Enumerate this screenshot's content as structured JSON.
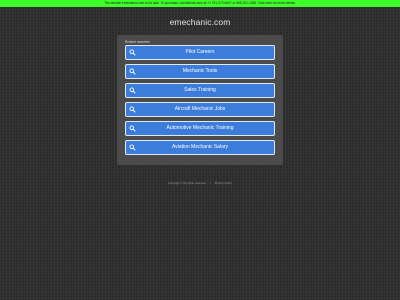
{
  "banner": {
    "text": "The domain emechanic.com is for sale. To purchase, call Afternic.com at +1 781-373-6847 or 855-201-2286. Click here for more details."
  },
  "site": {
    "title": "emechanic.com"
  },
  "panel": {
    "label": "Related searches",
    "items": [
      {
        "label": "Pilot Careers",
        "icon": "search-icon"
      },
      {
        "label": "Mechanic Tools",
        "icon": "search-icon"
      },
      {
        "label": "Sales Training",
        "icon": "search-icon"
      },
      {
        "label": "Aircraft Mechanic Jobs",
        "icon": "search-icon"
      },
      {
        "label": "Automotive Mechanic Training",
        "icon": "search-icon"
      },
      {
        "label": "Aviation Mechanic Salary",
        "icon": "search-icon"
      }
    ]
  },
  "footer": {
    "copyright": "Copyright © All rights reserved.",
    "privacy_label": "Privacy Policy"
  },
  "colors": {
    "background": "#2f2f2f",
    "banner": "#3fff2a",
    "panel": "#4b4b4b",
    "button": "#3c7ddc",
    "button_border": "#dfe9f8"
  }
}
